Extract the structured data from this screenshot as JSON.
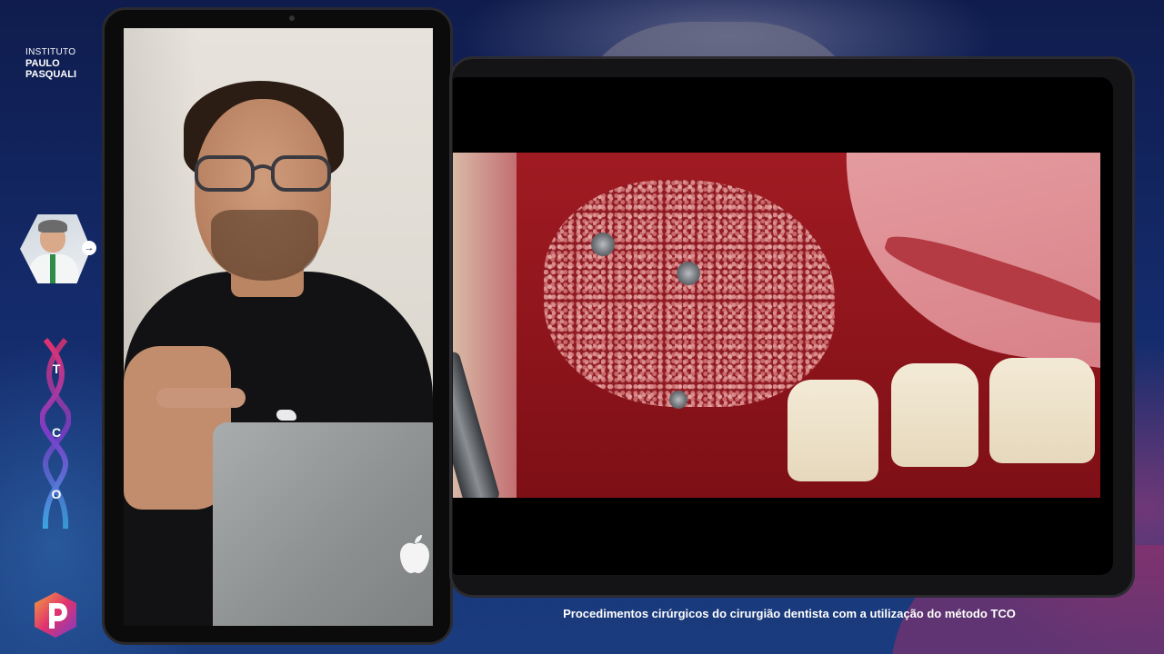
{
  "branding": {
    "line1": "INSTITUTO",
    "line2": "PAULO",
    "line3": "PASQUALI",
    "tco_letters": [
      "T",
      "C",
      "O"
    ],
    "p_logo_letter": "P"
  },
  "avatar": {
    "arrow_glyph": "→"
  },
  "caption": {
    "text": "Procedimentos cirúrgicos do cirurgião dentista com a utilização do método TCO"
  },
  "colors": {
    "background": "#0f1c4d",
    "accent_pink": "#e0326e",
    "accent_purple": "#7a3cc8",
    "helix_blue": "#3aa6e0"
  }
}
